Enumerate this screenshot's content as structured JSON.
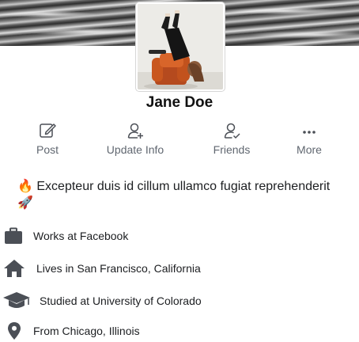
{
  "profile": {
    "name": "Jane Doe",
    "avatar_alt": "Profile photo"
  },
  "actions": [
    {
      "label": "Post",
      "icon": "edit-icon"
    },
    {
      "label": "Update Info",
      "icon": "user-add-icon"
    },
    {
      "label": "Friends",
      "icon": "friends-icon"
    },
    {
      "label": "More",
      "icon": "more-icon"
    }
  ],
  "bio": {
    "text": "Excepteur duis id cillum ullamco fugiat reprehenderit",
    "lead_emoji": "🔥",
    "trail_emoji": "🚀"
  },
  "details": [
    {
      "icon": "briefcase-icon",
      "text": "Works at Facebook"
    },
    {
      "icon": "home-icon",
      "text": "Lives in San Francisco, California"
    },
    {
      "icon": "graduation-cap-icon",
      "text": "Studied at University of Colorado"
    },
    {
      "icon": "location-pin-icon",
      "text": "From Chicago, Illinois"
    }
  ],
  "colors": {
    "icon": "#4b4f56",
    "label": "#606770",
    "text": "#1c1e21"
  }
}
